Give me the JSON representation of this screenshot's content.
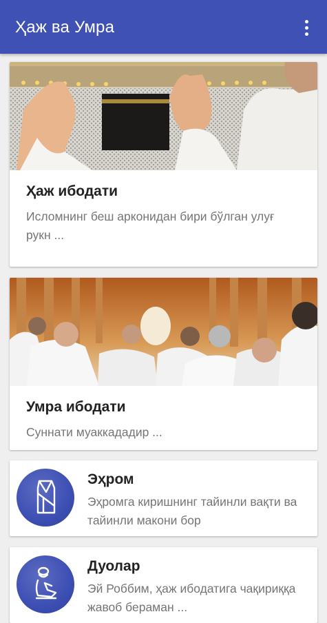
{
  "app": {
    "title": "Ҳаж ва Умра"
  },
  "cards": [
    {
      "title": "Ҳаж ибодати",
      "description": "Исломнинг беш арконидан бири бўлган улуғ рукн ..."
    },
    {
      "title": "Умра ибодати",
      "description": "Суннати муаккададир ..."
    },
    {
      "title": "Эҳром",
      "description": "Эҳромга киришнинг тайинли вақти ва тайинли макони бор"
    },
    {
      "title": "Дуолар",
      "description": "Эй Роббим, ҳаж ибодатига чақириққа жавоб бераман ..."
    }
  ],
  "colors": {
    "primary": "#3f51b5",
    "background": "#efefef",
    "icon_circle": "#3f51b5"
  },
  "icons": {
    "menu": "more-vert-icon",
    "card3": "ihram-garment-icon",
    "card4": "praying-person-icon"
  }
}
